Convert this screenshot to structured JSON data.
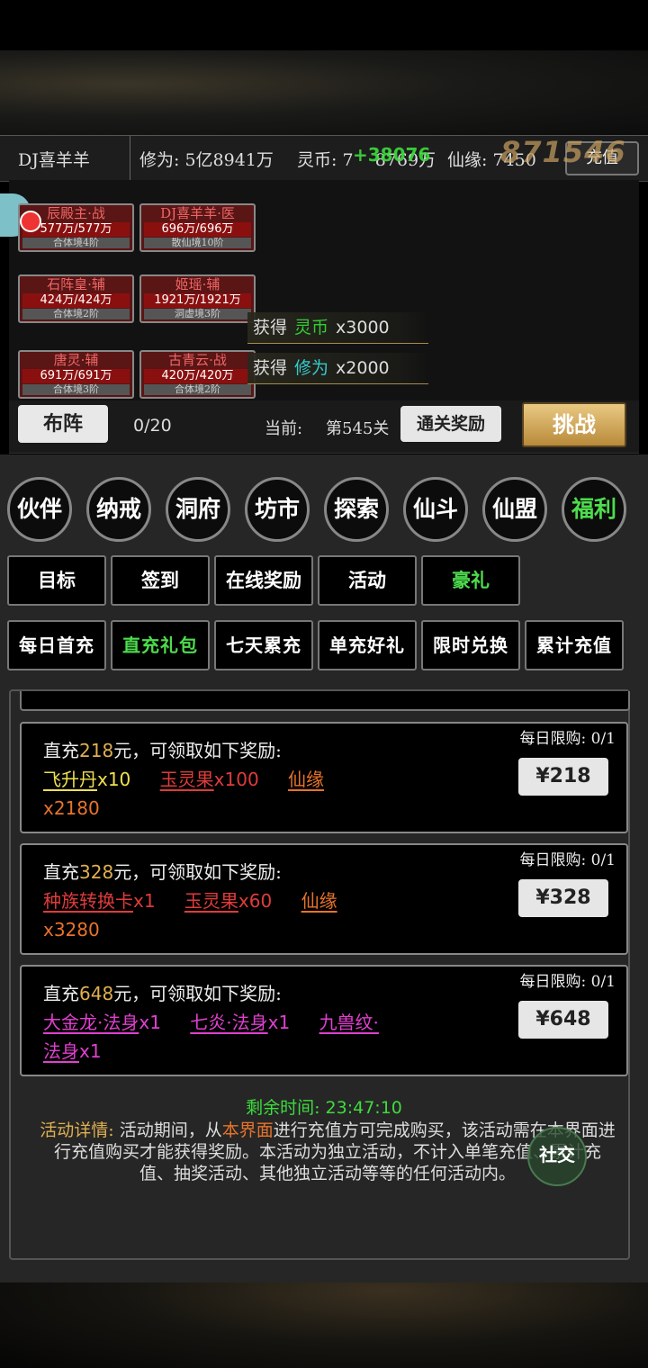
{
  "status": {
    "player_name": "DJ喜羊羊",
    "cultivation": "修为: 5亿8941万",
    "spirit_coin": "灵币: 7",
    "spirit_coin_rest": "8769万",
    "fate": "仙缘: 7450",
    "recharge_label": "充值",
    "float_green": "+38076",
    "float_gold": "871546"
  },
  "heroes": [
    {
      "name": "辰殿主·战",
      "hp": "577万/577万",
      "realm": "合体境4阶"
    },
    {
      "name": "DJ喜羊羊·医",
      "hp": "696万/696万",
      "realm": "散仙境10阶"
    },
    {
      "name": "石阵皇·辅",
      "hp": "424万/424万",
      "realm": "合体境2阶"
    },
    {
      "name": "姬瑶·辅",
      "hp": "1921万/1921万",
      "realm": "洞虚境3阶"
    },
    {
      "name": "唐灵·辅",
      "hp": "691万/691万",
      "realm": "合体境3阶"
    },
    {
      "name": "古青云·战",
      "hp": "420万/420万",
      "realm": "合体境2阶"
    }
  ],
  "gains": [
    {
      "prefix": "获得",
      "item": "灵币",
      "qty": "x3000"
    },
    {
      "prefix": "获得",
      "item": "修为",
      "qty": "x2000"
    }
  ],
  "formation": {
    "buzhen_label": "布阵",
    "progress": "0/20",
    "current_label": "当前:",
    "stage": "第545关",
    "clear_reward_label": "通关奖励",
    "challenge_label": "挑战"
  },
  "main_nav": [
    "伙伴",
    "纳戒",
    "洞府",
    "坊市",
    "探索",
    "仙斗",
    "仙盟",
    "福利"
  ],
  "tabs": [
    "目标",
    "签到",
    "在线奖励",
    "活动",
    "豪礼"
  ],
  "subtabs": [
    "每日首充",
    "直充礼包",
    "七天累充",
    "单充好礼",
    "限时兑换",
    "累计充值"
  ],
  "packages": [
    {
      "title_pre": "直充",
      "amount": "218",
      "title_post": "元，可领取如下奖励:",
      "limit": "每日限购: 0/1",
      "price": "¥218",
      "items": [
        {
          "name": "飞升丹",
          "qty": "x10",
          "color": "c-yellow"
        },
        {
          "name": "玉灵果",
          "qty": "x100",
          "color": "c-red"
        },
        {
          "name": "仙缘",
          "qty": "x2180",
          "color": "c-orange"
        }
      ]
    },
    {
      "title_pre": "直充",
      "amount": "328",
      "title_post": "元，可领取如下奖励:",
      "limit": "每日限购: 0/1",
      "price": "¥328",
      "items": [
        {
          "name": "种族转换卡",
          "qty": "x1",
          "color": "c-red"
        },
        {
          "name": "玉灵果",
          "qty": "x60",
          "color": "c-red"
        },
        {
          "name": "仙缘",
          "qty": "x3280",
          "color": "c-orange"
        }
      ]
    },
    {
      "title_pre": "直充",
      "amount": "648",
      "title_post": "元，可领取如下奖励:",
      "limit": "每日限购: 0/1",
      "price": "¥648",
      "items": [
        {
          "name": "大金龙·法身",
          "qty": "x1",
          "color": "c-pink"
        },
        {
          "name": "七炎·法身",
          "qty": "x1",
          "color": "c-pink"
        },
        {
          "name": "九兽纹·法身",
          "qty": "x1",
          "color": "c-pink"
        }
      ]
    }
  ],
  "timer": {
    "label": "剩余时间:",
    "value": "23:47:10"
  },
  "details": {
    "label": "活动详情:",
    "part1": "活动期间，从",
    "highlight": "本界面",
    "part2": "进行充值方可完成购买，该活动需在本界面进行充值购买才能获得奖励。本活动为独立活动，不计入单笔充值、累计充值、抽奖活动、其他独立活动等等的任何活动内。"
  },
  "social_label": "社交",
  "colors": {
    "active_green": "#4ddc4d",
    "gold": "#e0b050",
    "hp_red": "#8a1010"
  }
}
